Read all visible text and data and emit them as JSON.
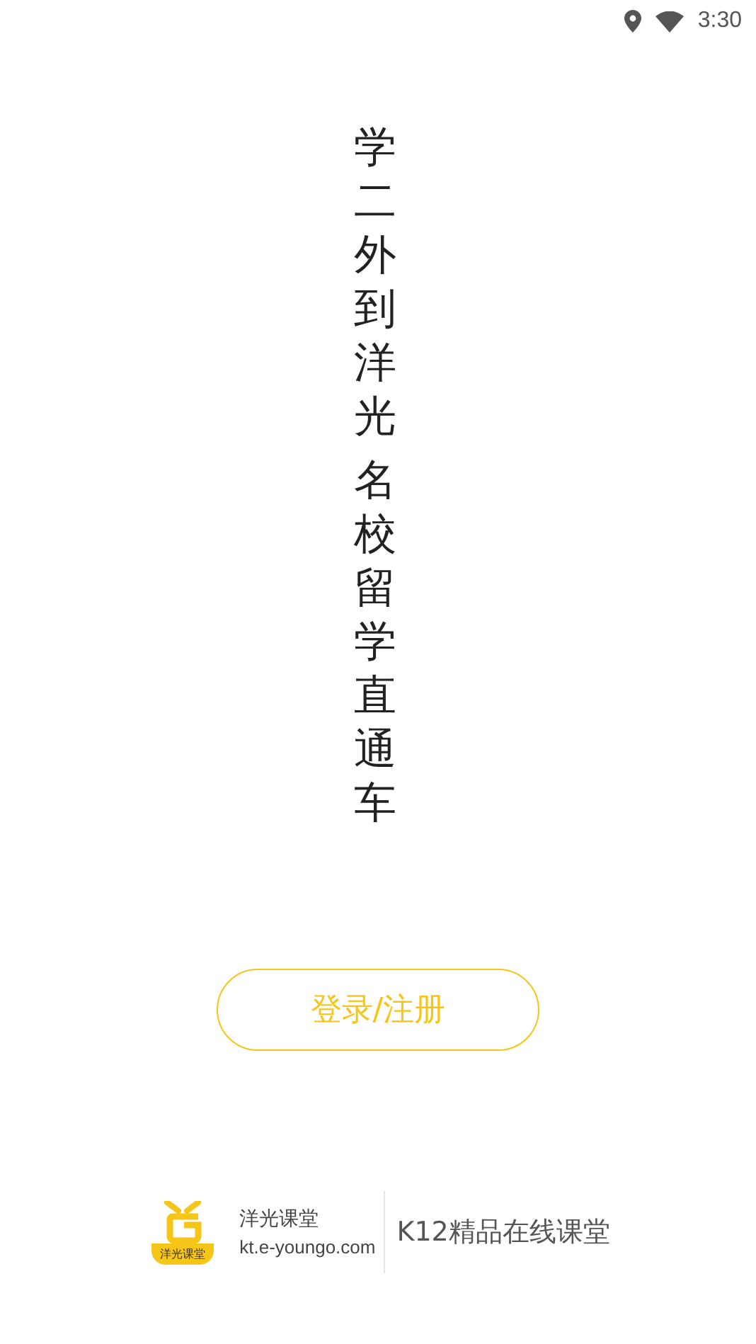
{
  "status_bar": {
    "time": "3:30"
  },
  "slogan": [
    "学二外到洋光",
    "名校留学直通车"
  ],
  "login_button": {
    "label": "登录/注册"
  },
  "footer": {
    "logo_caption": "洋光课堂",
    "brand_name": "洋光课堂",
    "website": "kt.e-youngo.com",
    "tagline": "K12精品在线课堂"
  }
}
